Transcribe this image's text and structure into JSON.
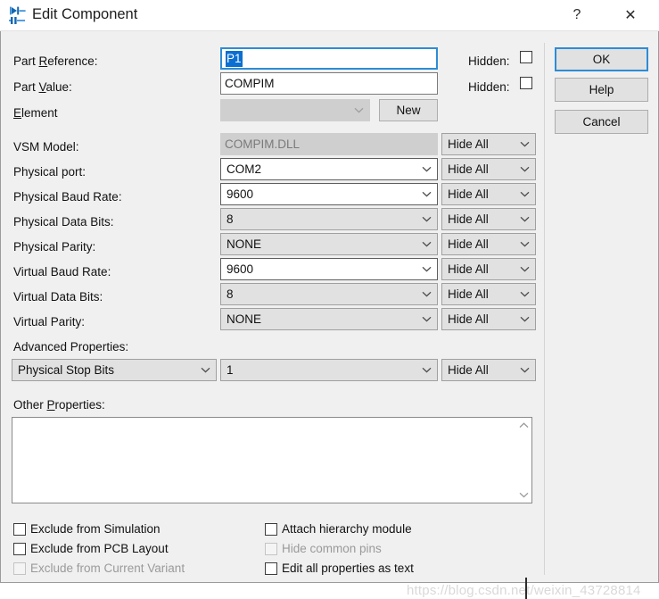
{
  "window": {
    "title": "Edit Component",
    "icon": "component-icon",
    "help_button": "?",
    "close_button": "✕"
  },
  "form": {
    "part_reference": {
      "label_pre": "Part ",
      "label_accel": "R",
      "label_post": "eference:",
      "value": "P1",
      "hidden_label": "Hidden:",
      "hidden_checked": false
    },
    "part_value": {
      "label_pre": "Part ",
      "label_accel": "V",
      "label_post": "alue:",
      "value": "COMPIM",
      "placeholder": "",
      "hidden_label": "Hidden:",
      "hidden_checked": false
    },
    "element": {
      "label_accel": "E",
      "label_post": "lement",
      "value": "",
      "disabled": true,
      "new_button": "New"
    },
    "rows": [
      {
        "label": "VSM Model:",
        "value": "COMPIM.DLL",
        "kind": "text",
        "state": "disabled",
        "hide": "Hide All"
      },
      {
        "label": "Physical port:",
        "value": "COM2",
        "kind": "combo",
        "state": "editable",
        "hide": "Hide All"
      },
      {
        "label": "Physical Baud Rate:",
        "value": "9600",
        "kind": "combo",
        "state": "editable",
        "hide": "Hide All"
      },
      {
        "label": "Physical Data Bits:",
        "value": "8",
        "kind": "combo",
        "state": "normal",
        "hide": "Hide All"
      },
      {
        "label": "Physical Parity:",
        "value": "NONE",
        "kind": "combo",
        "state": "normal",
        "hide": "Hide All"
      },
      {
        "label": "Virtual Baud Rate:",
        "value": "9600",
        "kind": "combo",
        "state": "editable",
        "hide": "Hide All"
      },
      {
        "label": "Virtual Data Bits:",
        "value": "8",
        "kind": "combo",
        "state": "normal",
        "hide": "Hide All"
      },
      {
        "label": "Virtual Parity:",
        "value": "NONE",
        "kind": "combo",
        "state": "normal",
        "hide": "Hide All"
      }
    ],
    "advanced": {
      "label": "Advanced Properties:",
      "property": "Physical Stop Bits",
      "value": "1",
      "hide": "Hide All"
    },
    "other": {
      "label_pre": "Other ",
      "label_accel": "P",
      "label_post": "roperties:",
      "value": "",
      "placeholder": ""
    }
  },
  "checkboxes_left": [
    {
      "label": "Exclude from Simulation",
      "checked": false,
      "disabled": false
    },
    {
      "label": "Exclude from PCB Layout",
      "checked": false,
      "disabled": false
    },
    {
      "label": "Exclude from Current Variant",
      "checked": false,
      "disabled": true
    }
  ],
  "checkboxes_right": [
    {
      "label": "Attach hierarchy module",
      "checked": false,
      "disabled": false
    },
    {
      "label": "Hide common pins",
      "checked": false,
      "disabled": true
    },
    {
      "label": "Edit all properties as text",
      "checked": false,
      "disabled": false
    }
  ],
  "buttons": {
    "ok": "OK",
    "help": "Help",
    "cancel": "Cancel"
  },
  "watermark": "https://blog.csdn.net/weixin_43728814",
  "colors": {
    "accent": "#0b6fd1",
    "focus_border": "#2d8cd6",
    "dialog_bg": "#f0f0f0",
    "field_bg": "#ffffff",
    "disabled_bg": "#cfcfcf",
    "combo_bg": "#e1e1e1"
  }
}
